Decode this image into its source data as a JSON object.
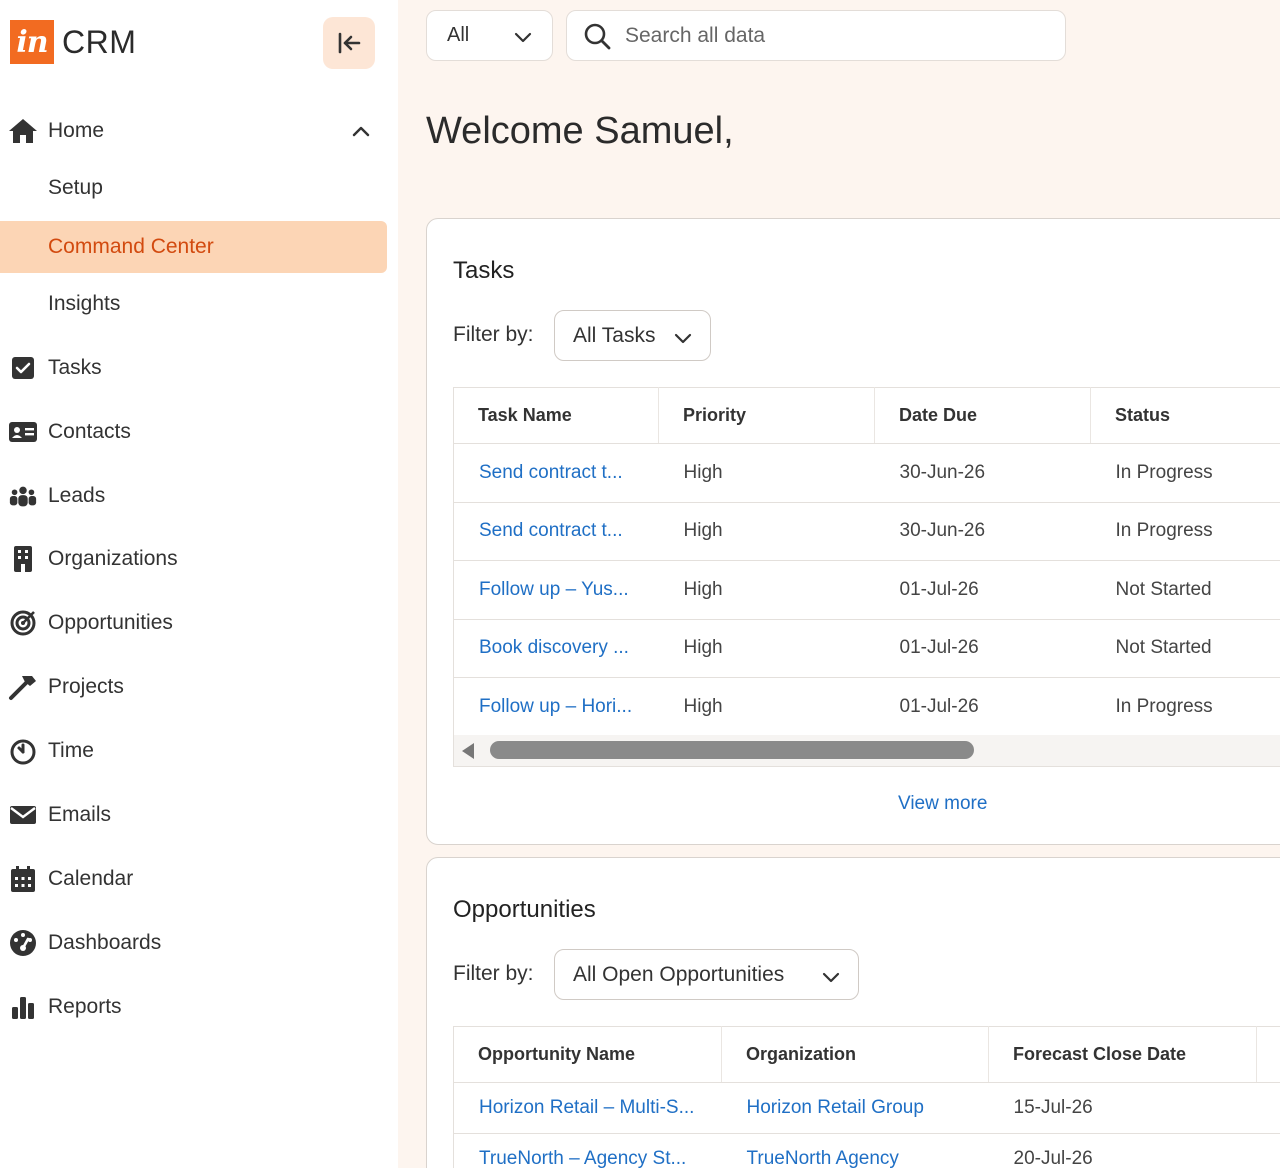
{
  "brand": {
    "logo_text": "in",
    "name": "CRM"
  },
  "sidebar": {
    "items": [
      {
        "label": "Home",
        "icon": "home-icon",
        "expanded": true
      },
      {
        "label": "Setup",
        "sub": true
      },
      {
        "label": "Command Center",
        "sub": true,
        "active": true
      },
      {
        "label": "Insights",
        "sub": true
      },
      {
        "label": "Tasks",
        "icon": "checkbox-icon"
      },
      {
        "label": "Contacts",
        "icon": "contact-card-icon"
      },
      {
        "label": "Leads",
        "icon": "people-group-icon"
      },
      {
        "label": "Organizations",
        "icon": "building-icon"
      },
      {
        "label": "Opportunities",
        "icon": "target-icon"
      },
      {
        "label": "Projects",
        "icon": "hammer-icon"
      },
      {
        "label": "Time",
        "icon": "timer-icon"
      },
      {
        "label": "Emails",
        "icon": "envelope-icon"
      },
      {
        "label": "Calendar",
        "icon": "calendar-icon"
      },
      {
        "label": "Dashboards",
        "icon": "dashboard-gauge-icon"
      },
      {
        "label": "Reports",
        "icon": "bar-chart-icon"
      }
    ]
  },
  "topbar": {
    "scope": "All",
    "search_placeholder": "Search all data"
  },
  "welcome": "Welcome Samuel,",
  "tasks": {
    "title": "Tasks",
    "filter_label": "Filter by:",
    "filter_value": "All Tasks",
    "columns": [
      "Task Name",
      "Priority",
      "Date Due",
      "Status"
    ],
    "rows": [
      [
        "Send contract t...",
        "High",
        "30-Jun-26",
        "In Progress"
      ],
      [
        "Send contract t...",
        "High",
        "30-Jun-26",
        "In Progress"
      ],
      [
        "Follow up – Yus...",
        "High",
        "01-Jul-26",
        "Not Started"
      ],
      [
        "Book discovery ...",
        "High",
        "01-Jul-26",
        "Not Started"
      ],
      [
        "Follow up – Hori...",
        "High",
        "01-Jul-26",
        "In Progress"
      ]
    ],
    "view_more": "View more"
  },
  "opportunities": {
    "title": "Opportunities",
    "filter_label": "Filter by:",
    "filter_value": "All Open Opportunities",
    "columns": [
      "Opportunity Name",
      "Organization",
      "Forecast Close Date"
    ],
    "rows": [
      [
        "Horizon Retail – Multi-S...",
        "Horizon Retail Group",
        "15-Jul-26"
      ],
      [
        "TrueNorth – Agency St...",
        "TrueNorth Agency",
        "20-Jul-26"
      ]
    ]
  },
  "colors": {
    "accent": "#f26b21",
    "active_bg": "#fcd5b5",
    "active_text": "#d24a0f",
    "link": "#1f6fc5"
  }
}
